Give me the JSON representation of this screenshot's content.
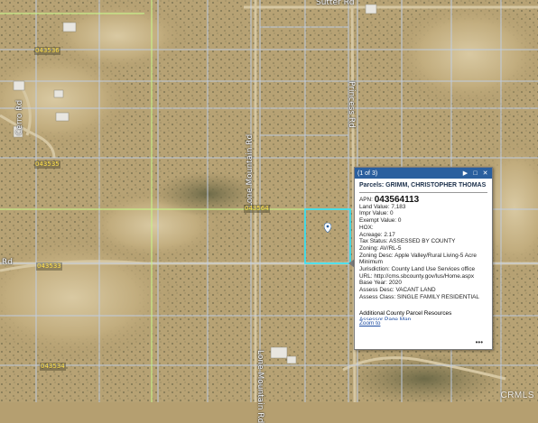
{
  "map": {
    "roads": [
      {
        "id": "sutter",
        "label": "Sutter Rd"
      },
      {
        "id": "princess",
        "label": "Princess Rd"
      },
      {
        "id": "mountain",
        "label": "Lone Mountain Rd"
      },
      {
        "id": "cerro",
        "label": "Cerro Rd"
      },
      {
        "id": "left",
        "label": "Rd"
      },
      {
        "id": "mountain_lower",
        "label": "Lone Mountain Rd"
      },
      {
        "id": "princess_lower",
        "label": "Rd"
      }
    ],
    "parcel_labels": [
      "043536",
      "043535",
      "043564",
      "043533",
      "043534"
    ],
    "selected_parcel_color": "#2ee6ff",
    "road_color": "#bfcfea",
    "highlight_road_color": "#c7f08a"
  },
  "popup": {
    "count": "(1 of 3)",
    "header": "Parcels: GRIMM, CHRISTOPHER THOMAS",
    "apn_label": "APN:",
    "apn_value": "043564113",
    "fields": [
      "Land Value: 7,183",
      "Impr Value: 0",
      "Exempt Value: 0",
      "HOX:",
      "Acreage: 2.17",
      "Tax Status: ASSESSED BY COUNTY",
      "Zoning: AV/RL-5",
      "Zoning Desc: Apple Valley/Rural Living-5 Acre Minimum",
      "Jurisdiction: County Land Use Services office",
      "URL: http://cms.sbcounty.gov/lus/Home.aspx",
      "Base Year: 2020",
      "Assess Desc: VACANT LAND",
      "Assess Class: SINGLE FAMILY RESIDENTIAL"
    ],
    "footer_title": "Additional County Parcel Resources",
    "footer_cut": "Assessor Page Map",
    "zoom_link": "Zoom to",
    "more": "•••",
    "titlebar_color": "#2a5f9e"
  },
  "watermark": "CRMLS"
}
